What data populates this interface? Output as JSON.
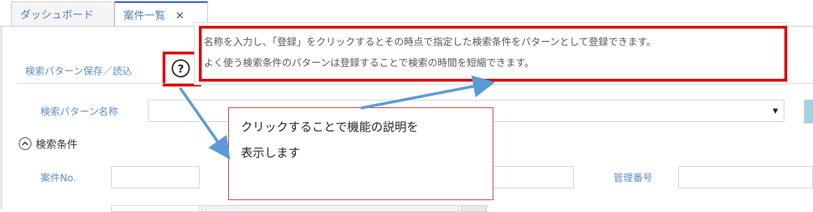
{
  "tabs": [
    {
      "label": "ダッシュボード"
    },
    {
      "label": "案件一覧",
      "close": "×"
    }
  ],
  "search_pattern": {
    "section_title": "検索パターン保存／読込",
    "help_icon": "?",
    "tooltip_line1": "名称を入力し、「登録」をクリックするとその時点で指定した検索条件をパターンとして登録できます。",
    "tooltip_line2": "よく使う検索条件のパターンは登録することで検索の時間を短縮できます。",
    "name_label": "検索パターン名称",
    "name_value": ""
  },
  "search_conditions": {
    "title": "検索条件",
    "toggle_icon": "chevron-up-icon",
    "case_no_label": "案件No.",
    "management_no_label": "管理番号"
  },
  "callout": {
    "line1": "クリックすることで機能の説明を",
    "line2": "表示します"
  },
  "colors": {
    "annotation_red": "#e00000",
    "arrow_blue": "#5b9bd5",
    "label_blue": "#5b8bc8",
    "active_tab_border": "#1a3fd6"
  }
}
